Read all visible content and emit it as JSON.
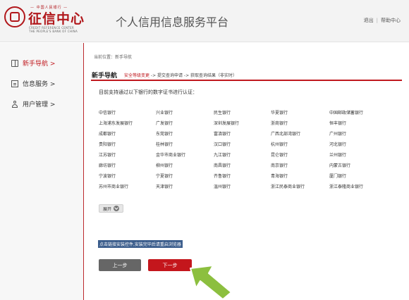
{
  "header": {
    "logo_top": "— 中国人民银行 —",
    "logo_name": "征信中心",
    "logo_en_line1": "CREDIT REFERENCE CENTER",
    "logo_en_line2": "THE PEOPLE'S BANK OF CHINA",
    "platform_title": "个人信用信息服务平台",
    "logout": "退出",
    "help": "帮助中心",
    "separator": "|"
  },
  "sidebar": {
    "items": [
      {
        "label": "新手导航 >",
        "icon": "book-icon",
        "active": true
      },
      {
        "label": "信息服务 >",
        "icon": "document-icon",
        "active": false
      },
      {
        "label": "用户管理 >",
        "icon": "user-icon",
        "active": false
      }
    ]
  },
  "main": {
    "breadcrumb": "当前位置：新手导航",
    "tab_title": "新手导航",
    "steps": {
      "active": "安全等级变更",
      "rest": " -> 提交查询申请 -> 获取查询结果（非实时）"
    },
    "intro": "目前支持通过以下银行的数字证书进行认证：",
    "banks": [
      [
        "中信银行",
        "兴业银行",
        "民生银行",
        "华夏银行",
        "中国邮政储蓄银行"
      ],
      [
        "上海浦东发展银行",
        "广发银行",
        "深圳发展银行",
        "浙商银行",
        "恒丰银行"
      ],
      [
        "成都银行",
        "东莞银行",
        "富滇银行",
        "广西北部湾银行",
        "广州银行"
      ],
      [
        "贵阳银行",
        "桂林银行",
        "汉口银行",
        "杭州银行",
        "河北银行"
      ],
      [
        "江苏银行",
        "金华市商业银行",
        "九江银行",
        "昆仑银行",
        "兰州银行"
      ],
      [
        "廊坊银行",
        "柳州银行",
        "南昌银行",
        "南京银行",
        "内蒙古银行"
      ],
      [
        "宁波银行",
        "宁夏银行",
        "齐鲁银行",
        "青海银行",
        "厦门银行"
      ],
      [
        "苏州市商业银行",
        "天津银行",
        "温州银行",
        "浙江民泰商业银行",
        "浙江泰隆商业银行"
      ]
    ],
    "expand_label": "展开",
    "install_link": "点击链接安装控件,安装完毕后请重启浏览器",
    "prev_label": "上一步",
    "next_label": "下一步"
  },
  "colors": {
    "accent": "#c0181e",
    "next_button": "#c4161c",
    "prev_button": "#666666",
    "arrow_green": "#8cbf3f"
  }
}
